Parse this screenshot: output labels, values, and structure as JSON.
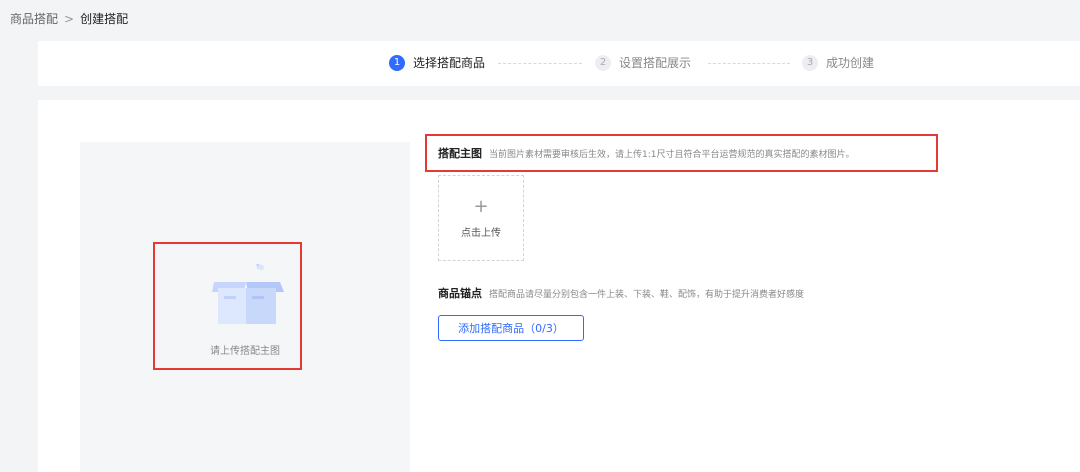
{
  "breadcrumb": {
    "parent": "商品搭配",
    "separator": ">",
    "current": "创建搭配"
  },
  "steps": [
    {
      "num": "1",
      "label": "选择搭配商品",
      "state": "active"
    },
    {
      "num": "2",
      "label": "设置搭配展示",
      "state": "inactive"
    },
    {
      "num": "3",
      "label": "成功创建",
      "state": "inactive"
    }
  ],
  "preview": {
    "hint": "请上传搭配主图",
    "icon": "empty-box-icon"
  },
  "main_image": {
    "label": "搭配主图",
    "desc": "当前图片素材需要审核后生效，请上传1:1尺寸且符合平台运营规范的真实搭配的素材图片。",
    "upload_icon": "+",
    "upload_label": "点击上传"
  },
  "anchor": {
    "label": "商品锚点",
    "desc": "搭配商品请尽量分别包含一件上装、下装、鞋、配饰，有助于提升消费者好感度",
    "button_label": "添加搭配商品（0/3）"
  },
  "colors": {
    "accent": "#2f6bff",
    "highlight": "#e53935"
  }
}
